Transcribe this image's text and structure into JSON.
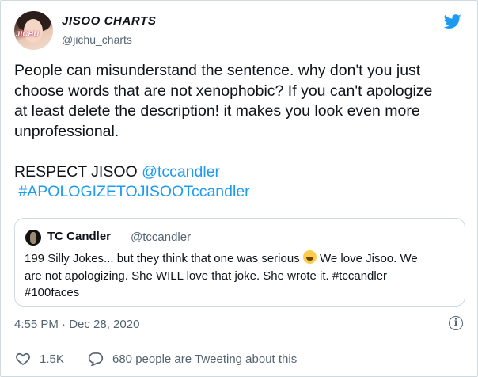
{
  "author": {
    "name": "JISOO CHARTS",
    "handle": "@jichu_charts",
    "avatar_label": "JICHU"
  },
  "tweet": {
    "line1": "People can misunderstand the sentence. why don't you just",
    "line2": "choose words that are not xenophobic? If you can't apologize",
    "line3": "at least delete the description! it makes you look even more",
    "line4": "unprofessional.",
    "respect_prefix": "RESPECT JISOO ",
    "mention": "@tccandler",
    "hashtag": "#APOLOGIZETOJISOOTccandler"
  },
  "quote": {
    "name": "TC Candler",
    "handle": "@tccandler",
    "line1_before_emoji": "199 Silly Jokes... but they think that one was serious ",
    "emoji": "rolling-on-floor-laughing-emoji",
    "line1_after_emoji": " We love Jisoo.  We",
    "line2": "are not apologizing.  She WILL love that joke.  She wrote it. #tccandler",
    "line3": "#100faces"
  },
  "timestamp": "4:55 PM · Dec 28, 2020",
  "likes": "1.5K",
  "tweeting": "680 people are Tweeting about this",
  "icons": {
    "brand": "twitter-bird-icon",
    "info": "info-icon",
    "like": "heart-icon",
    "reply": "speech-bubble-icon"
  },
  "colors": {
    "link": "#1d9bf0",
    "muted": "#536471",
    "text": "#0f1419"
  }
}
